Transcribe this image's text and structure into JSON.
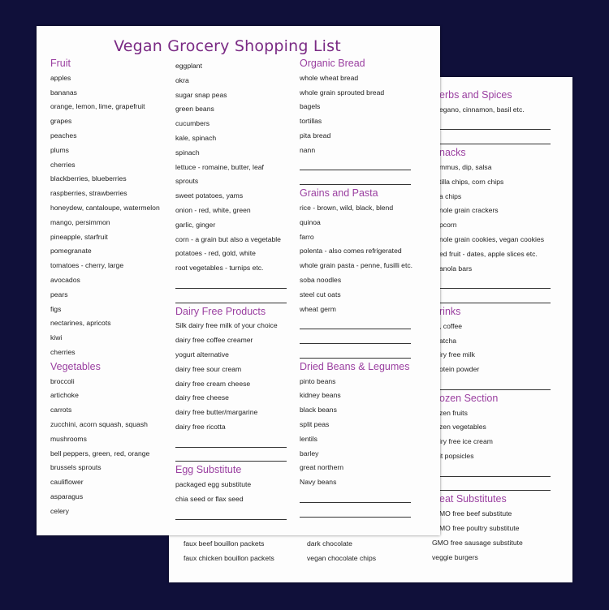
{
  "title": "Vegan Grocery Shopping List",
  "colors": {
    "heading": "#9a3fa0",
    "title": "#7a2a84",
    "background": "#10103a"
  },
  "front": {
    "columns": [
      [
        {
          "t": "h",
          "text": "Fruit"
        },
        {
          "text": "apples"
        },
        {
          "text": "bananas"
        },
        {
          "text": "orange, lemon, lime, grapefruit"
        },
        {
          "text": "grapes"
        },
        {
          "text": "peaches"
        },
        {
          "text": "plums"
        },
        {
          "text": "cherries"
        },
        {
          "text": "blackberries, blueberries"
        },
        {
          "text": "raspberries, strawberries"
        },
        {
          "text": "honeydew, cantaloupe, watermelon"
        },
        {
          "text": "mango, persimmon"
        },
        {
          "text": "pineapple, starfruit"
        },
        {
          "text": "pomegranate"
        },
        {
          "text": "tomatoes - cherry, large"
        },
        {
          "text": "avocados"
        },
        {
          "text": "pears"
        },
        {
          "text": "figs"
        },
        {
          "text": "nectarines, apricots"
        },
        {
          "text": "kiwi"
        },
        {
          "text": "cherries"
        },
        {
          "t": "h",
          "text": "Vegetables"
        },
        {
          "text": "broccoli"
        },
        {
          "text": "artichoke"
        },
        {
          "text": "carrots"
        },
        {
          "text": "zucchini, acorn squash, squash"
        },
        {
          "text": "mushrooms"
        },
        {
          "text": "bell peppers, green, red, orange"
        },
        {
          "text": "brussels sprouts"
        },
        {
          "text": "cauliflower"
        },
        {
          "text": "asparagus"
        },
        {
          "text": "celery"
        }
      ],
      [
        {
          "text": "eggplant"
        },
        {
          "text": "okra"
        },
        {
          "text": "sugar snap peas"
        },
        {
          "text": "green beans"
        },
        {
          "text": "cucumbers"
        },
        {
          "text": "kale, spinach"
        },
        {
          "text": "spinach"
        },
        {
          "text": "lettuce - romaine, butter, leaf"
        },
        {
          "text": "sprouts"
        },
        {
          "text": "sweet potatoes, yams"
        },
        {
          "text": "onion - red, white, green"
        },
        {
          "text": "garlic, ginger"
        },
        {
          "text": "corn - a grain but also a vegetable"
        },
        {
          "text": "potatoes - red, gold, white"
        },
        {
          "text": "root vegetables - turnips etc."
        },
        {
          "t": "line"
        },
        {
          "t": "line"
        },
        {
          "t": "h",
          "text": "Dairy Free Products"
        },
        {
          "text": "Silk dairy free milk of your choice"
        },
        {
          "text": "dairy free coffee creamer"
        },
        {
          "text": "yogurt alternative"
        },
        {
          "text": "dairy free sour cream"
        },
        {
          "text": "dairy free cream cheese"
        },
        {
          "text": "dairy free cheese"
        },
        {
          "text": "dairy free butter/margarine"
        },
        {
          "text": "dairy free ricotta"
        },
        {
          "t": "line"
        },
        {
          "t": "line"
        },
        {
          "t": "h",
          "text": "Egg Substitute"
        },
        {
          "text": "packaged egg substitute"
        },
        {
          "text": "chia seed or flax seed"
        },
        {
          "t": "line"
        }
      ],
      [
        {
          "t": "h",
          "text": "Organic Bread"
        },
        {
          "text": "whole wheat bread"
        },
        {
          "text": "whole grain sprouted bread"
        },
        {
          "text": "bagels"
        },
        {
          "text": "tortillas"
        },
        {
          "text": "pita bread"
        },
        {
          "text": "nann"
        },
        {
          "t": "line"
        },
        {
          "t": "line"
        },
        {
          "t": "h",
          "text": "Grains and Pasta"
        },
        {
          "text": "rice - brown, wild, black, blend"
        },
        {
          "text": "quinoa"
        },
        {
          "text": "farro"
        },
        {
          "text": "polenta - also comes refrigerated"
        },
        {
          "text": "whole grain pasta - penne, fusilli etc."
        },
        {
          "text": "soba noodles"
        },
        {
          "text": "steel cut oats"
        },
        {
          "text": "wheat germ"
        },
        {
          "t": "line"
        },
        {
          "t": "line"
        },
        {
          "t": "line"
        },
        {
          "t": "h",
          "text": "Dried Beans & Legumes"
        },
        {
          "text": "pinto beans"
        },
        {
          "text": "kidney beans"
        },
        {
          "text": "black beans"
        },
        {
          "text": "split peas"
        },
        {
          "text": "lentils"
        },
        {
          "text": "barley"
        },
        {
          "text": "great northern"
        },
        {
          "text": "Navy beans"
        },
        {
          "t": "line"
        },
        {
          "t": "line"
        }
      ]
    ]
  },
  "back": {
    "columns": [
      [
        {
          "text": "faux beef bouillon packets"
        },
        {
          "text": "faux chicken bouillon packets"
        }
      ],
      [
        {
          "text": "dark chocolate"
        },
        {
          "text": "vegan chocolate chips"
        }
      ],
      [
        {
          "t": "h",
          "text": "erbs and Spices"
        },
        {
          "text": "egano, cinnamon, basil etc."
        },
        {
          "t": "line"
        },
        {
          "t": "line"
        },
        {
          "t": "h",
          "text": "nacks"
        },
        {
          "text": "mmus, dip, salsa"
        },
        {
          "text": "tilla chips, corn chips"
        },
        {
          "text": "a chips"
        },
        {
          "text": "nole grain crackers"
        },
        {
          "text": "pcorn"
        },
        {
          "text": "nole grain cookies, vegan cookies"
        },
        {
          "text": "ed fruit - dates, apple slices etc."
        },
        {
          "text": "anola bars"
        },
        {
          "t": "line"
        },
        {
          "t": "line"
        },
        {
          "t": "h",
          "text": "rinks"
        },
        {
          "text": ", coffee"
        },
        {
          "text": "atcha"
        },
        {
          "text": "iry free milk"
        },
        {
          "text": "otein powder"
        },
        {
          "t": "line"
        },
        {
          "t": "h",
          "text": "ozen Section"
        },
        {
          "text": "zen fruits"
        },
        {
          "text": "zen vegetables"
        },
        {
          "text": "iry free ice cream"
        },
        {
          "text": "it popsicles"
        },
        {
          "t": "line"
        },
        {
          "t": "line"
        },
        {
          "t": "h",
          "text": "eat Substitutes"
        },
        {
          "text": "MO free beef substitute"
        },
        {
          "text": "MO free poultry substitute"
        },
        {
          "t": "full",
          "text": "GMO free sausage substitute"
        },
        {
          "t": "full",
          "text": "veggie burgers"
        }
      ]
    ]
  }
}
